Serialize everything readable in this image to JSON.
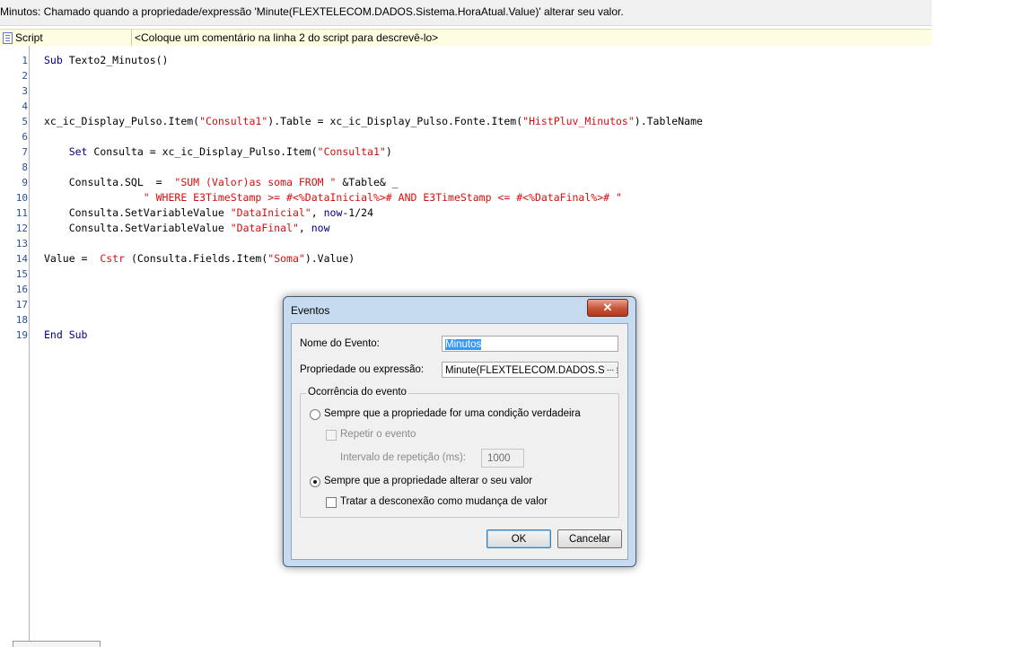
{
  "header": {
    "description": "Minutos: Chamado quando a propriedade/expressão 'Minute(FLEXTELECOM.DADOS.Sistema.HoraAtual.Value)' alterar seu valor."
  },
  "script_bar": {
    "label": "Script",
    "comment_placeholder": "<Coloque um comentário na linha 2 do script para descrevê-lo>",
    "icon": "script-document-icon"
  },
  "editor": {
    "line_numbers": [
      "1",
      "2",
      "3",
      "4",
      "5",
      "6",
      "7",
      "8",
      "9",
      "10",
      "11",
      "12",
      "13",
      "14",
      "15",
      "16",
      "17",
      "18",
      "19"
    ],
    "lines": [
      [
        {
          "t": "Sub",
          "k": "kw"
        },
        {
          "t": " Texto2_Minutos()"
        }
      ],
      [],
      [],
      [],
      [
        {
          "t": "xc_ic_Display_Pulso.Item("
        },
        {
          "t": "\"Consulta1\"",
          "k": "str"
        },
        {
          "t": ").Table = xc_ic_Display_Pulso.Fonte.Item("
        },
        {
          "t": "\"HistPluv_Minutos\"",
          "k": "str"
        },
        {
          "t": ").TableName"
        }
      ],
      [],
      [
        {
          "t": "    "
        },
        {
          "t": "Set",
          "k": "kw"
        },
        {
          "t": " Consulta = xc_ic_Display_Pulso.Item("
        },
        {
          "t": "\"Consulta1\"",
          "k": "str"
        },
        {
          "t": ")"
        }
      ],
      [],
      [
        {
          "t": "    Consulta.SQL  =  "
        },
        {
          "t": "\"SUM (Valor)as soma FROM \"",
          "k": "str"
        },
        {
          "t": " &Table& _"
        }
      ],
      [
        {
          "t": "                "
        },
        {
          "t": "\" WHERE E3TimeStamp >= #<%DataInicial%># AND E3TimeStamp <= #<%DataFinal%># \"",
          "k": "str"
        }
      ],
      [
        {
          "t": "    Consulta.SetVariableValue "
        },
        {
          "t": "\"DataInicial\"",
          "k": "str"
        },
        {
          "t": ", "
        },
        {
          "t": "now",
          "k": "kw"
        },
        {
          "t": "-1/24"
        }
      ],
      [
        {
          "t": "    Consulta.SetVariableValue "
        },
        {
          "t": "\"DataFinal\"",
          "k": "str"
        },
        {
          "t": ", "
        },
        {
          "t": "now",
          "k": "kw"
        }
      ],
      [],
      [
        {
          "t": "Value =  "
        },
        {
          "t": "Cstr",
          "k": "str"
        },
        {
          "t": " (Consulta.Fields.Item("
        },
        {
          "t": "\"Soma\"",
          "k": "str"
        },
        {
          "t": ").Value)"
        }
      ],
      [],
      [],
      [],
      [],
      [
        {
          "t": "End Sub",
          "k": "kw"
        }
      ]
    ]
  },
  "dialog": {
    "title": "Eventos",
    "close_glyph": "✕",
    "event_name_label": "Nome do Evento:",
    "event_name_value": "Minutos",
    "expression_label": "Propriedade ou expressão:",
    "expression_value": "Minute(FLEXTELECOM.DADOS.Sister",
    "expression_browse": "...",
    "group_title": "Ocorrência do evento",
    "option_true_condition": "Sempre que a propriedade for uma condição verdadeira",
    "option_true_condition_selected": false,
    "repeat_event_label": "Repetir o evento",
    "repeat_event_checked": false,
    "repeat_interval_label": "Intervalo de repetição (ms):",
    "repeat_interval_value": "1000",
    "option_value_change": "Sempre que a propriedade alterar o seu valor",
    "option_value_change_selected": true,
    "disconnect_label": "Tratar a desconexão como mudança de valor",
    "disconnect_checked": false,
    "ok_label": "OK",
    "cancel_label": "Cancelar"
  }
}
